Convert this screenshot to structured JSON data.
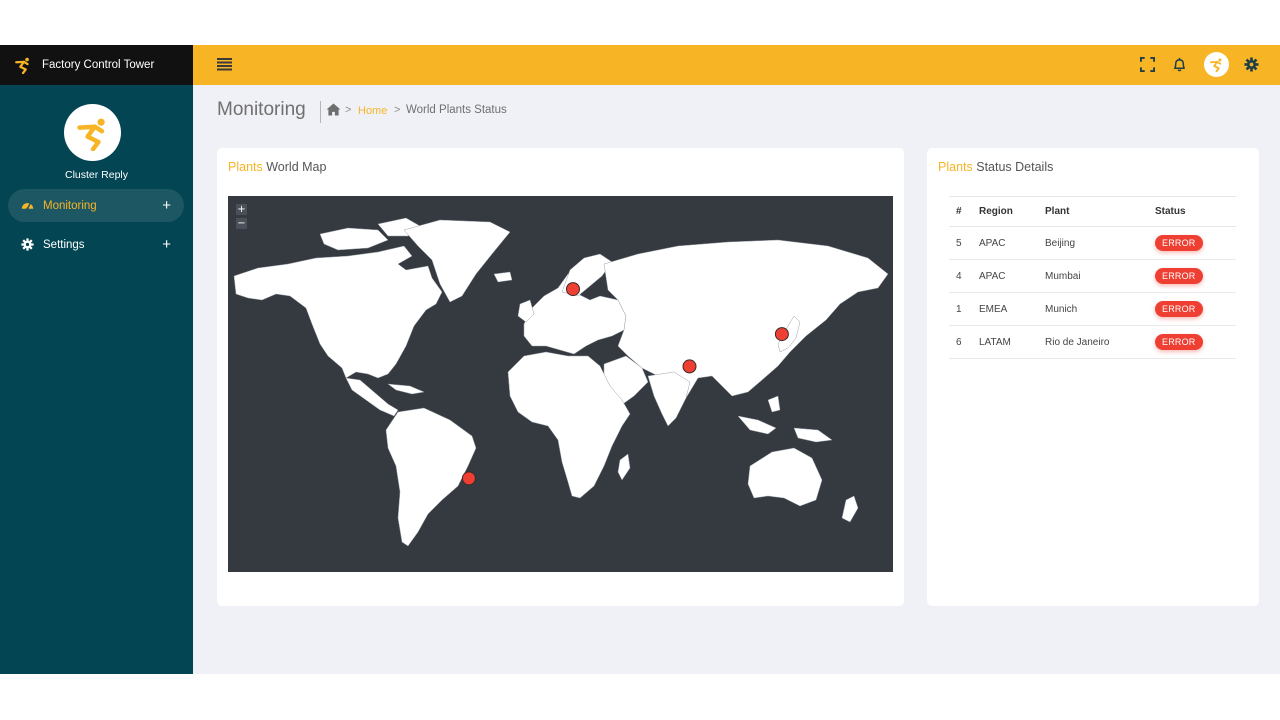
{
  "brand": {
    "name": "Factory Control Tower"
  },
  "user": {
    "name": "Cluster Reply"
  },
  "sidebar": {
    "items": [
      {
        "label": "Monitoring",
        "icon": "dashboard-icon",
        "active": true
      },
      {
        "label": "Settings",
        "icon": "gear-icon",
        "active": false
      }
    ],
    "expand_symbol": "+"
  },
  "topbar": {
    "icons": [
      "menu-icon",
      "expand-icon",
      "bell-icon",
      "avatar",
      "gear-icon"
    ]
  },
  "header": {
    "title": "Monitoring",
    "breadcrumb": {
      "separator": ">",
      "home": "Home",
      "current": "World Plants Status"
    }
  },
  "map_card": {
    "title_accent": "Plants",
    "title_rest": "World Map",
    "zoom_in": "+",
    "zoom_out": "−",
    "markers": [
      {
        "plant": "Munich",
        "lon": 11.6,
        "lat": 48.1
      },
      {
        "plant": "Beijing",
        "lon": 121.5,
        "lat": 31.2
      },
      {
        "plant": "Mumbai",
        "lon": 72.9,
        "lat": 19.1
      },
      {
        "plant": "Rio de Janeiro",
        "lon": -43.2,
        "lat": -22.9
      }
    ]
  },
  "status_card": {
    "title_accent": "Plants",
    "title_rest": "Status Details",
    "columns": [
      "#",
      "Region",
      "Plant",
      "Status"
    ],
    "rows": [
      {
        "num": "5",
        "region": "APAC",
        "plant": "Beijing",
        "status": "ERROR"
      },
      {
        "num": "4",
        "region": "APAC",
        "plant": "Mumbai",
        "status": "ERROR"
      },
      {
        "num": "1",
        "region": "EMEA",
        "plant": "Munich",
        "status": "ERROR"
      },
      {
        "num": "6",
        "region": "LATAM",
        "plant": "Rio de Janeiro",
        "status": "ERROR"
      }
    ]
  },
  "colors": {
    "accent": "#f7b526",
    "sidebar": "#044553",
    "brand_bar": "#111111",
    "map_background": "#353a41",
    "error": "#ee3f32",
    "page_background": "#f0f1f6"
  }
}
